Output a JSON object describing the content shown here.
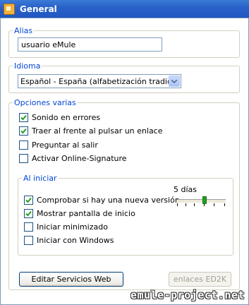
{
  "window": {
    "title": "General"
  },
  "alias": {
    "legend": "Alias",
    "value": "usuario eMule"
  },
  "idioma": {
    "legend": "Idioma",
    "selected": "Español - España (alfabetización tradicional"
  },
  "opciones": {
    "legend": "Opciones varias",
    "items": [
      {
        "label": "Sonido en errores",
        "checked": true
      },
      {
        "label": "Traer al frente al pulsar un enlace",
        "checked": true
      },
      {
        "label": "Preguntar al salir",
        "checked": false
      },
      {
        "label": "Activar Online-Signature",
        "checked": false
      }
    ]
  },
  "al_iniciar": {
    "legend": "Al iniciar",
    "items": [
      {
        "label": "Comprobar si hay una nueva versión",
        "checked": true
      },
      {
        "label": "Mostrar pantalla de inicio",
        "checked": true
      },
      {
        "label": "Iniciar minimizado",
        "checked": false
      },
      {
        "label": "Iniciar con Windows",
        "checked": false
      }
    ],
    "slider_label": "5 días",
    "slider_value": 5
  },
  "buttons": {
    "edit_web": "Editar Servicios Web",
    "ed2k": "enlaces ED2K"
  },
  "watermark": "emule-project.net"
}
